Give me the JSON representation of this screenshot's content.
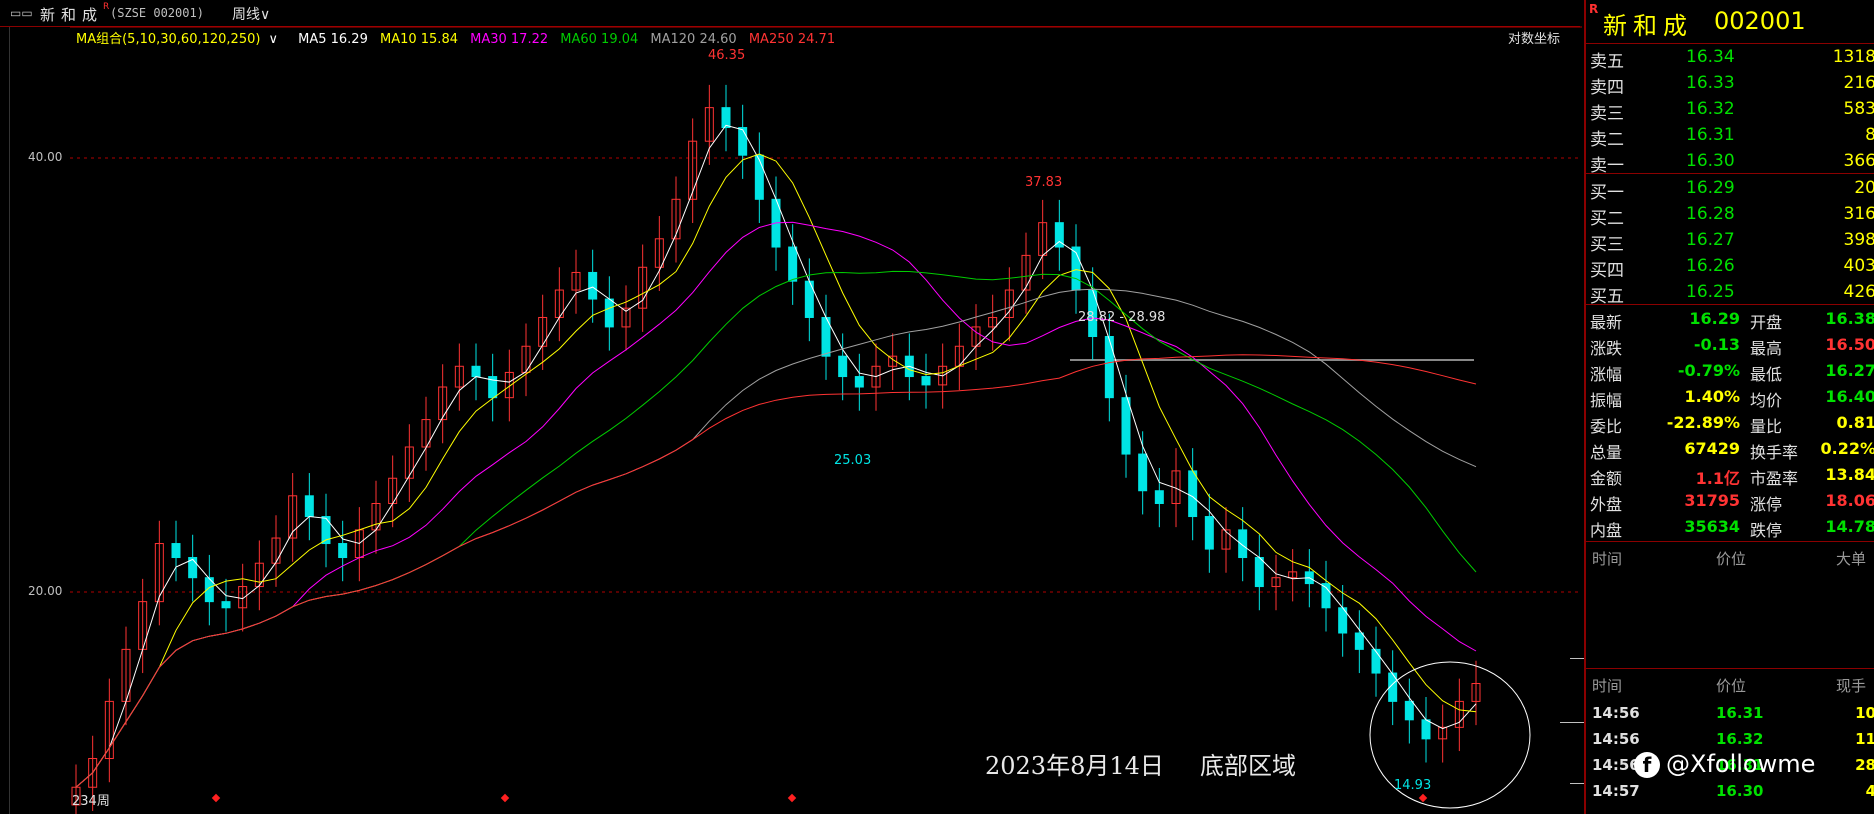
{
  "topbar": {
    "menu_icon": "▭▭",
    "stock_name": "新和成",
    "badge": "R",
    "code_display": "(SZSE 002001)",
    "period": "周线",
    "period_caret": "∨"
  },
  "ma_legend": {
    "group": "MA组合(5,10,30,60,120,250)",
    "group_caret": "∨",
    "ma5": "MA5 16.29",
    "ma10": "MA10 15.84",
    "ma30": "MA30 17.22",
    "ma60": "MA60 19.04",
    "ma120": "MA120 24.60",
    "ma250": "MA250 24.71",
    "colors": {
      "ma5": "#ffffff",
      "ma10": "#ffff00",
      "ma30": "#ff00ff",
      "ma60": "#00cc00",
      "ma120": "#a0a0a0",
      "ma250": "#ff3333"
    }
  },
  "log_coord": "对数坐标",
  "y_axis": {
    "labels": [
      "40.00",
      "20.00"
    ]
  },
  "annotations": {
    "high": "46.35",
    "second_high": "37.83",
    "mid_low": "25.03",
    "low": "14.93",
    "range": "28.82 - 28.98",
    "period_count": "234周",
    "overlay_date": "2023年8月14日",
    "overlay_note": "底部区域"
  },
  "colors": {
    "up": "#ff3333",
    "down": "#00e5e5",
    "frame": "#b00000",
    "grid": "#b00000",
    "buy_sell_price": "#00e000",
    "volume": "#ffff00"
  },
  "chart_data": {
    "type": "candlestick",
    "title": "",
    "xlabel": "",
    "ylabel": "",
    "scale": "log",
    "ylim": [
      13.5,
      50
    ],
    "close": [
      13.8,
      14.5,
      16.0,
      17.5,
      19.0,
      21.0,
      20.5,
      19.8,
      19.0,
      18.8,
      19.5,
      20.3,
      21.2,
      22.8,
      22.0,
      21.0,
      20.5,
      21.5,
      22.5,
      23.5,
      24.8,
      26.0,
      27.5,
      28.5,
      28.0,
      27.0,
      28.2,
      29.5,
      31.0,
      32.5,
      33.5,
      32.0,
      30.5,
      31.5,
      33.8,
      35.5,
      38.0,
      42.0,
      44.5,
      43.0,
      41.0,
      38.0,
      35.0,
      33.0,
      31.0,
      29.0,
      28.0,
      27.5,
      28.5,
      29.0,
      28.0,
      27.6,
      28.5,
      29.5,
      30.5,
      31.0,
      32.5,
      34.5,
      36.5,
      35.0,
      32.5,
      30.0,
      27.0,
      24.5,
      23.0,
      22.5,
      23.8,
      22.0,
      20.8,
      21.5,
      20.5,
      19.5,
      19.8,
      20.0,
      19.6,
      18.8,
      18.0,
      17.5,
      16.8,
      16.0,
      15.5,
      15.0,
      15.3,
      16.0,
      16.5
    ],
    "ma": {
      "ma5_last": 16.29,
      "ma10_last": 15.84,
      "ma30_last": 17.22,
      "ma60_last": 19.04,
      "ma120_last": 24.6,
      "ma250_last": 24.71
    }
  },
  "right_panel": {
    "badge": "R",
    "name": "新和成",
    "code": "002001",
    "sells": [
      {
        "label": "卖五",
        "price": "16.34",
        "volume": "1318"
      },
      {
        "label": "卖四",
        "price": "16.33",
        "volume": "216"
      },
      {
        "label": "卖三",
        "price": "16.32",
        "volume": "583"
      },
      {
        "label": "卖二",
        "price": "16.31",
        "volume": "8"
      },
      {
        "label": "卖一",
        "price": "16.30",
        "volume": "366"
      }
    ],
    "buys": [
      {
        "label": "买一",
        "price": "16.29",
        "volume": "20"
      },
      {
        "label": "买二",
        "price": "16.28",
        "volume": "316"
      },
      {
        "label": "买三",
        "price": "16.27",
        "volume": "398"
      },
      {
        "label": "买四",
        "price": "16.26",
        "volume": "403"
      },
      {
        "label": "买五",
        "price": "16.25",
        "volume": "426"
      }
    ],
    "stats": [
      {
        "l1": "最新",
        "v1": "16.29",
        "c1": "#00e000",
        "l2": "开盘",
        "v2": "16.38",
        "c2": "#00e000"
      },
      {
        "l1": "涨跌",
        "v1": "-0.13",
        "c1": "#00e000",
        "l2": "最高",
        "v2": "16.50",
        "c2": "#ff3333"
      },
      {
        "l1": "涨幅",
        "v1": "-0.79%",
        "c1": "#00e000",
        "l2": "最低",
        "v2": "16.27",
        "c2": "#00e000"
      },
      {
        "l1": "振幅",
        "v1": "1.40%",
        "c1": "#ffff00",
        "l2": "均价",
        "v2": "16.40",
        "c2": "#00e000"
      },
      {
        "l1": "委比",
        "v1": "-22.89%",
        "c1": "#ffff00",
        "l2": "量比",
        "v2": "0.81",
        "c2": "#ffff00"
      },
      {
        "l1": "总量",
        "v1": "67429",
        "c1": "#ffff00",
        "l2": "换手率",
        "v2": "0.22%",
        "c2": "#ffff00"
      },
      {
        "l1": "金额",
        "v1": "1.1亿",
        "c1": "#ff3333",
        "l2": "市盈率",
        "v2": "13.84",
        "c2": "#ffff00"
      },
      {
        "l1": "外盘",
        "v1": "31795",
        "c1": "#ff3333",
        "l2": "涨停",
        "v2": "18.06",
        "c2": "#ff3333"
      },
      {
        "l1": "内盘",
        "v1": "35634",
        "c1": "#00e000",
        "l2": "跌停",
        "v2": "14.78",
        "c2": "#00e000"
      }
    ],
    "big_order_header": {
      "time": "时间",
      "price": "价位",
      "big": "大单"
    },
    "tick_header": {
      "time": "时间",
      "price": "价位",
      "hand": "现手"
    },
    "ticks": [
      {
        "time": "14:56",
        "price": "16.31",
        "vol": "10"
      },
      {
        "time": "14:56",
        "price": "16.32",
        "vol": "11"
      },
      {
        "time": "14:56",
        "price": "16.31",
        "vol": "28"
      },
      {
        "time": "14:57",
        "price": "16.30",
        "vol": "4"
      }
    ]
  },
  "watermark": {
    "icon": "f",
    "text": "@Xfollowme"
  }
}
